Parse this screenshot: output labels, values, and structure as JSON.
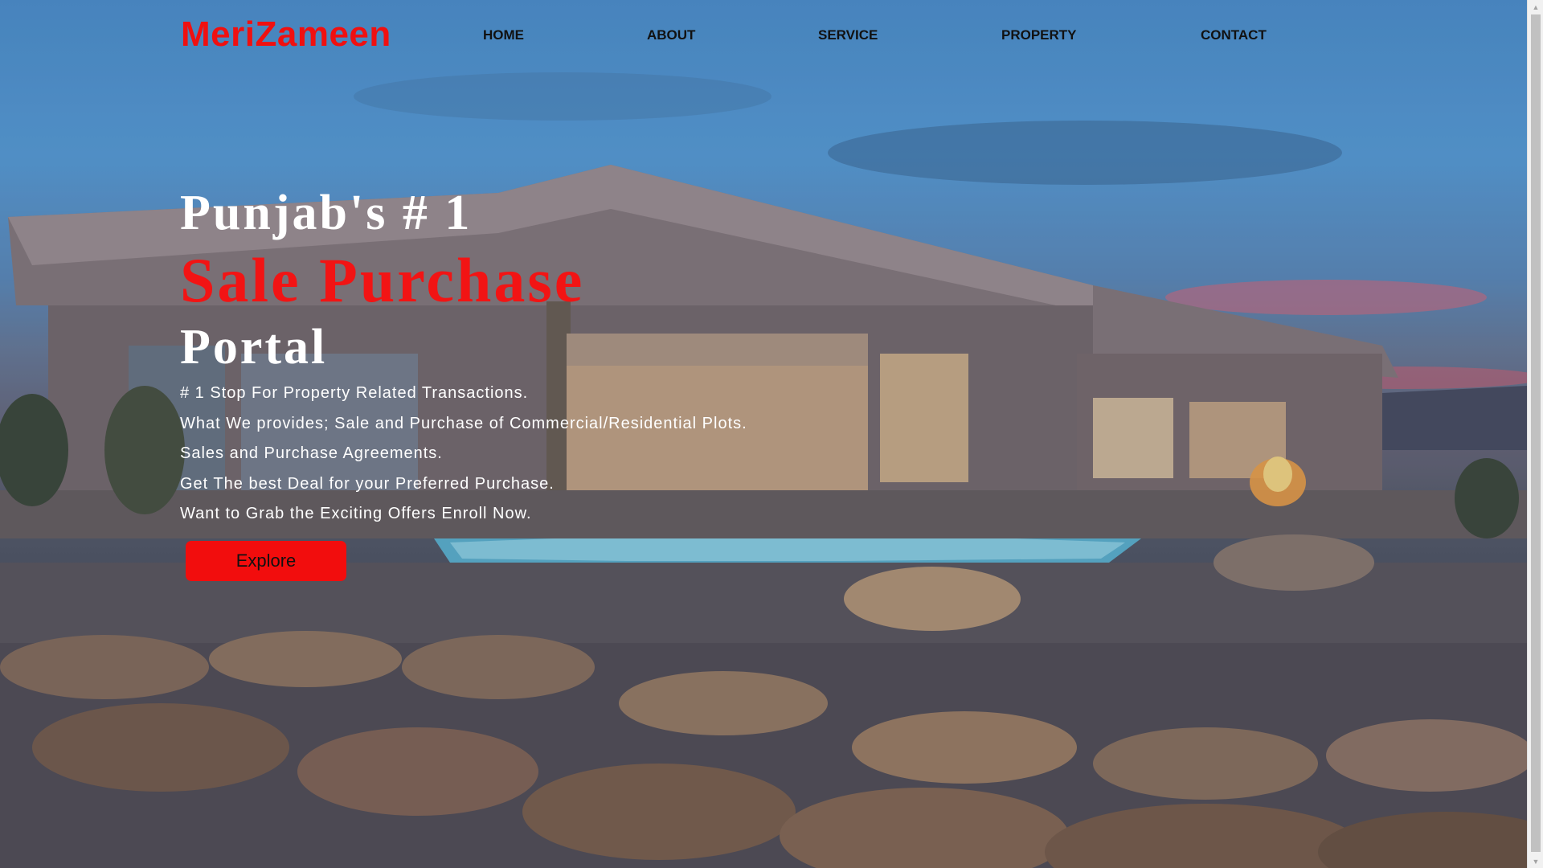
{
  "brand": {
    "logo_text": "MeriZameen",
    "logo_color": "#f01010"
  },
  "nav": {
    "items": [
      {
        "label": "HOME"
      },
      {
        "label": "ABOUT"
      },
      {
        "label": "SERVICE"
      },
      {
        "label": "PROPERTY"
      },
      {
        "label": "CONTACT"
      }
    ]
  },
  "hero": {
    "line1": "Punjab's # 1",
    "line2": "Sale Purchase",
    "line3": "Portal",
    "accent_color": "#f21414",
    "points": [
      "# 1 Stop For Property Related Transactions.",
      "What We provides; Sale and Purchase of Commercial/Residential Plots.",
      "Sales and Purchase Agreements.",
      "Get The best Deal for your Preferred Purchase.",
      "Want to Grab the Exciting Offers Enroll Now."
    ],
    "cta_label": "Explore",
    "cta_color": "#f20d0d"
  },
  "background": {
    "description_icon": "house-photo"
  }
}
